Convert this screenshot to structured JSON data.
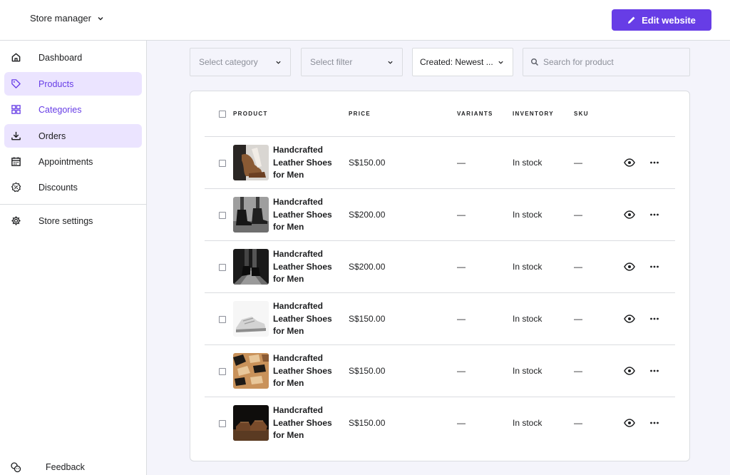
{
  "header": {
    "store_name": "Store manager",
    "edit_button": "Edit website",
    "accent": "#673de6"
  },
  "sidebar": {
    "items": [
      {
        "label": "Dashboard",
        "icon": "home-icon"
      },
      {
        "label": "Products",
        "icon": "tag-icon"
      },
      {
        "label": "Categories",
        "icon": "grid-icon"
      },
      {
        "label": "Orders",
        "icon": "download-icon"
      },
      {
        "label": "Appointments",
        "icon": "calendar-icon"
      },
      {
        "label": "Discounts",
        "icon": "discount-icon"
      }
    ],
    "settings": {
      "label": "Store settings",
      "icon": "gear-icon"
    },
    "feedback": {
      "label": "Feedback",
      "icon": "feedback-icon"
    }
  },
  "filters": {
    "category_placeholder": "Select category",
    "filter_placeholder": "Select filter",
    "sort_label": "Created:",
    "sort_value": "Newest ...",
    "search_placeholder": "Search for product"
  },
  "table": {
    "columns": [
      "PRODUCT",
      "PRICE",
      "VARIANTS",
      "INVENTORY",
      "SKU"
    ],
    "rows": [
      {
        "name": "Handcrafted Leather Shoes for Men",
        "price": "S$150.00",
        "variants": "—",
        "inventory": "In stock",
        "sku": "—",
        "thumb": "photo of brown boots held in hand"
      },
      {
        "name": "Handcrafted Leather Shoes for Men",
        "price": "S$200.00",
        "variants": "—",
        "inventory": "In stock",
        "sku": "—",
        "thumb": "photo of black ankle boots"
      },
      {
        "name": "Handcrafted Leather Shoes for Men",
        "price": "S$200.00",
        "variants": "—",
        "inventory": "In stock",
        "sku": "—",
        "thumb": "photo of black boots on stage"
      },
      {
        "name": "Handcrafted Leather Shoes for Men",
        "price": "S$150.00",
        "variants": "—",
        "inventory": "In stock",
        "sku": "—",
        "thumb": "photo of white sneaker"
      },
      {
        "name": "Handcrafted Leather Shoes for Men",
        "price": "S$150.00",
        "variants": "—",
        "inventory": "In stock",
        "sku": "—",
        "thumb": "photo of tan sandals"
      },
      {
        "name": "Handcrafted Leather Shoes for Men",
        "price": "S$150.00",
        "variants": "—",
        "inventory": "In stock",
        "sku": "—",
        "thumb": "photo of brown shoes"
      }
    ]
  }
}
